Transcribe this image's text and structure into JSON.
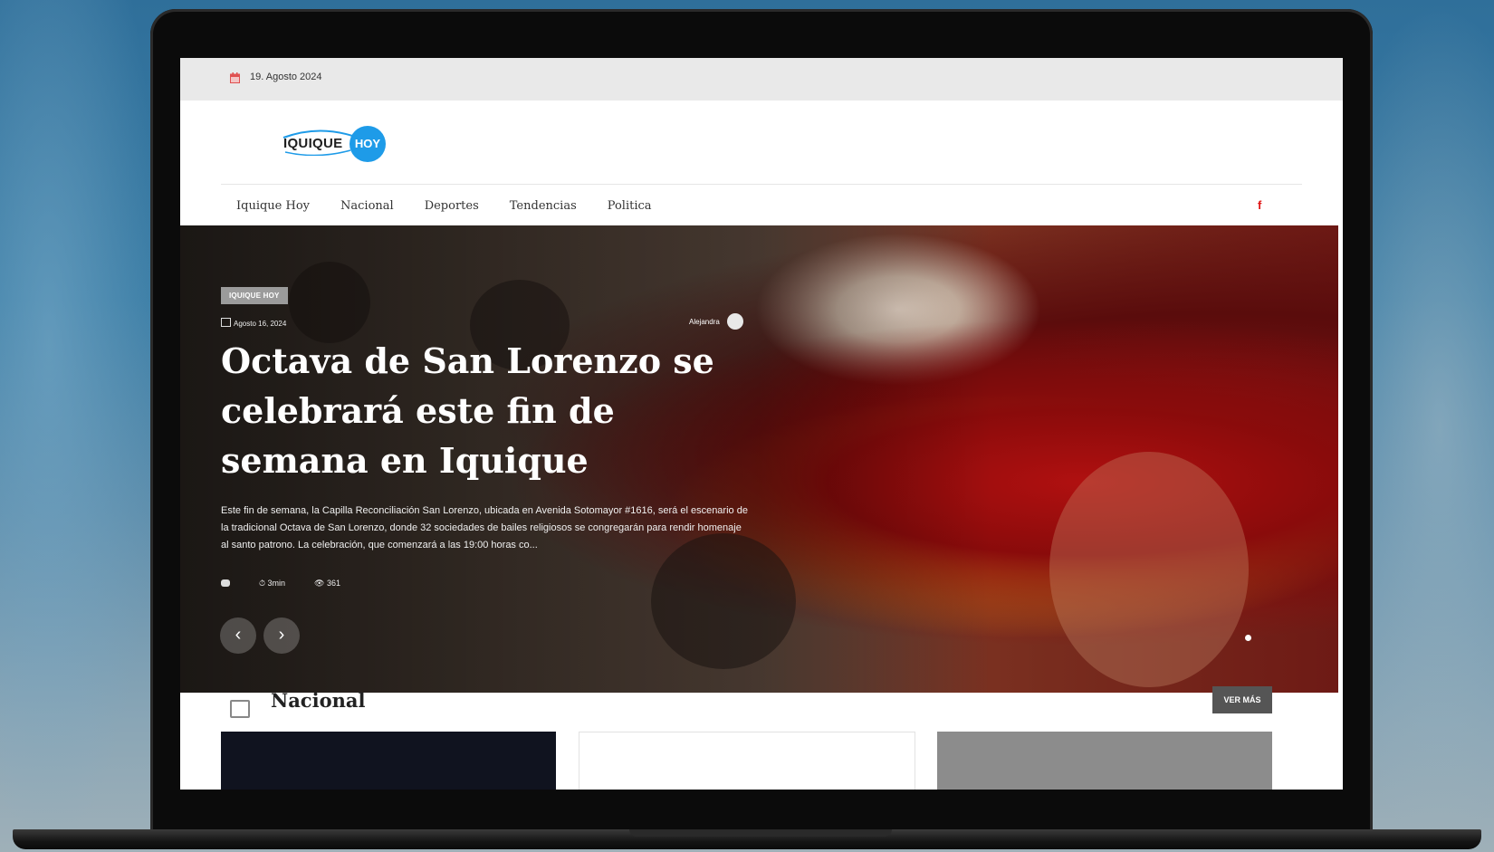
{
  "topbar": {
    "date": "19. Agosto 2024"
  },
  "header": {
    "logo_text": "IQUIQUE",
    "logo_badge": "HOY"
  },
  "nav": {
    "items": [
      "Iquique Hoy",
      "Nacional",
      "Deportes",
      "Tendencias",
      "Politica"
    ],
    "social": "f"
  },
  "hero": {
    "category": "IQUIQUE HOY",
    "date": "Agosto 16, 2024",
    "author": "Alejandra",
    "title": "Octava de San Lorenzo se celebrará este fin de semana en Iquique",
    "excerpt": "Este fin de semana, la Capilla Reconciliación San Lorenzo, ubicada en Avenida Sotomayor #1616, será el escenario de la tradicional Octava de San Lorenzo, donde 32 sociedades de bailes religiosos se congregarán para rendir homenaje al santo patrono. La celebración, que comenzará a las 19:00 horas co...",
    "read_time": "3min",
    "views": "361",
    "prev": "‹",
    "next": "›"
  },
  "section": {
    "title": "Nacional",
    "more_label": "VER MÁS"
  },
  "colors": {
    "accent_blue": "#1e9be8",
    "facebook_red": "#e01818",
    "topbar_bg": "#e9e9e9"
  }
}
